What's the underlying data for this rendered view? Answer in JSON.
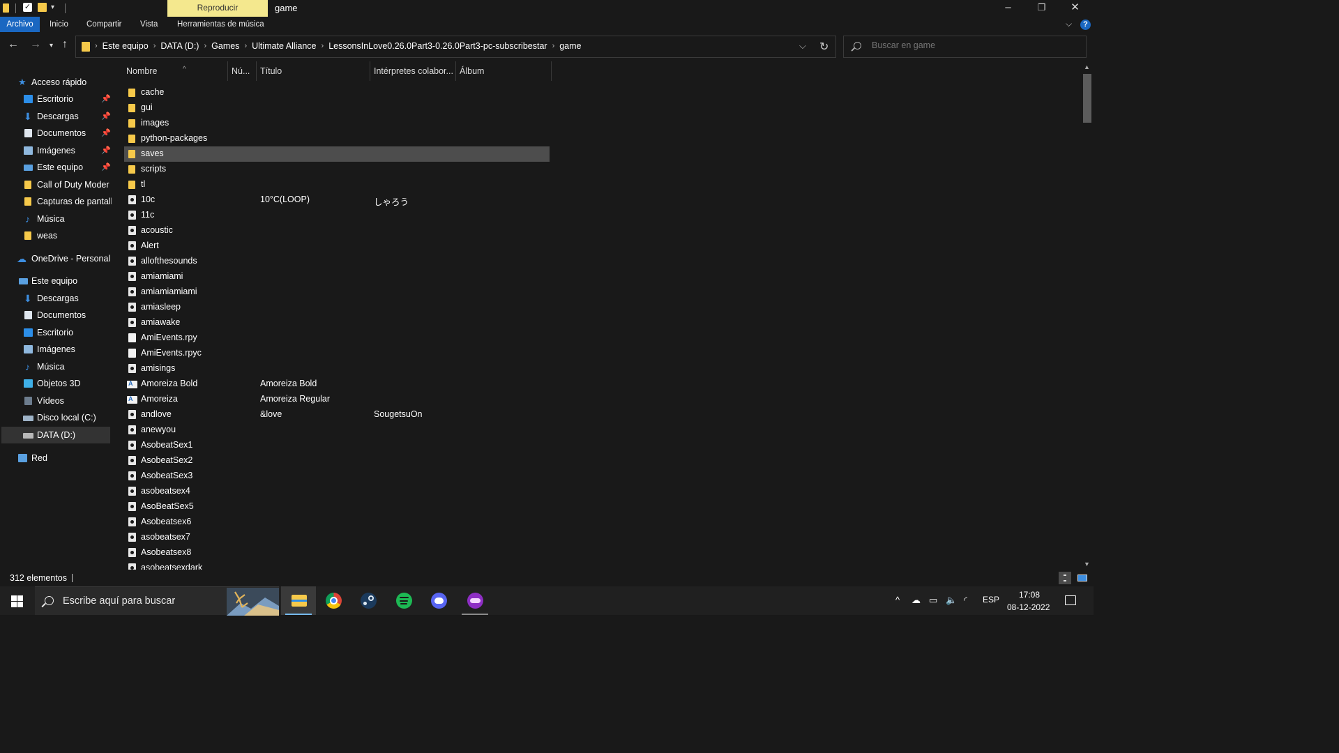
{
  "window": {
    "title": "game",
    "contextual_tab": "Reproducir"
  },
  "ribbon": {
    "tabs": [
      "Archivo",
      "Inicio",
      "Compartir",
      "Vista",
      "Herramientas de música"
    ]
  },
  "address": {
    "crumbs": [
      "Este equipo",
      "DATA (D:)",
      "Games",
      "Ultimate Alliance",
      "LessonsInLove0.26.0Part3-0.26.0Part3-pc-subscribestar",
      "game"
    ]
  },
  "search": {
    "placeholder": "Buscar en game"
  },
  "nav": {
    "quick_access": "Acceso rápido",
    "quick_items": [
      "Escritorio",
      "Descargas",
      "Documentos",
      "Imágenes",
      "Este equipo",
      "Call of Duty  Moder",
      "Capturas de pantall",
      "Música",
      "weas"
    ],
    "onedrive": "OneDrive - Personal",
    "this_pc": "Este equipo",
    "pc_items": [
      "Descargas",
      "Documentos",
      "Escritorio",
      "Imágenes",
      "Música",
      "Objetos 3D",
      "Vídeos",
      "Disco local (C:)",
      "DATA (D:)"
    ],
    "network": "Red"
  },
  "columns": [
    "Nombre",
    "Nú...",
    "Título",
    "Intérpretes colabor...",
    "Álbum"
  ],
  "files": [
    {
      "name": "cache",
      "type": "folder",
      "title": "",
      "artist": ""
    },
    {
      "name": "gui",
      "type": "folder",
      "title": "",
      "artist": ""
    },
    {
      "name": "images",
      "type": "folder",
      "title": "",
      "artist": ""
    },
    {
      "name": "python-packages",
      "type": "folder",
      "title": "",
      "artist": ""
    },
    {
      "name": "saves",
      "type": "folder",
      "title": "",
      "artist": ""
    },
    {
      "name": "scripts",
      "type": "folder",
      "title": "",
      "artist": ""
    },
    {
      "name": "tl",
      "type": "folder",
      "title": "",
      "artist": ""
    },
    {
      "name": "10c",
      "type": "audio",
      "title": "10°C(LOOP)",
      "artist": "しゃろう"
    },
    {
      "name": "11c",
      "type": "audio",
      "title": "",
      "artist": ""
    },
    {
      "name": "acoustic",
      "type": "audio",
      "title": "",
      "artist": ""
    },
    {
      "name": "Alert",
      "type": "audio",
      "title": "",
      "artist": ""
    },
    {
      "name": "allofthesounds",
      "type": "audio",
      "title": "",
      "artist": ""
    },
    {
      "name": "amiamiami",
      "type": "audio",
      "title": "",
      "artist": ""
    },
    {
      "name": "amiamiamiami",
      "type": "audio",
      "title": "",
      "artist": ""
    },
    {
      "name": "amiasleep",
      "type": "audio",
      "title": "",
      "artist": ""
    },
    {
      "name": "amiawake",
      "type": "audio",
      "title": "",
      "artist": ""
    },
    {
      "name": "AmiEvents.rpy",
      "type": "doc",
      "title": "",
      "artist": ""
    },
    {
      "name": "AmiEvents.rpyc",
      "type": "doc",
      "title": "",
      "artist": ""
    },
    {
      "name": "amisings",
      "type": "audio",
      "title": "",
      "artist": ""
    },
    {
      "name": "Amoreiza Bold",
      "type": "font",
      "title": "Amoreiza Bold",
      "artist": ""
    },
    {
      "name": "Amoreiza",
      "type": "font",
      "title": "Amoreiza Regular",
      "artist": ""
    },
    {
      "name": "andlove",
      "type": "audio",
      "title": "&love",
      "artist": "SougetsuOn"
    },
    {
      "name": "anewyou",
      "type": "audio",
      "title": "",
      "artist": ""
    },
    {
      "name": "AsobeatSex1",
      "type": "audio",
      "title": "",
      "artist": ""
    },
    {
      "name": "AsobeatSex2",
      "type": "audio",
      "title": "",
      "artist": ""
    },
    {
      "name": "AsobeatSex3",
      "type": "audio",
      "title": "",
      "artist": ""
    },
    {
      "name": "asobeatsex4",
      "type": "audio",
      "title": "",
      "artist": ""
    },
    {
      "name": "AsoBeatSex5",
      "type": "audio",
      "title": "",
      "artist": ""
    },
    {
      "name": "Asobeatsex6",
      "type": "audio",
      "title": "",
      "artist": ""
    },
    {
      "name": "asobeatsex7",
      "type": "audio",
      "title": "",
      "artist": ""
    },
    {
      "name": "Asobeatsex8",
      "type": "audio",
      "title": "",
      "artist": ""
    },
    {
      "name": "asobeatsexdark",
      "type": "audio",
      "title": "",
      "artist": ""
    }
  ],
  "selected_file": "saves",
  "status": {
    "count": "312 elementos"
  },
  "taskbar": {
    "search_text": "Escribe aquí para buscar",
    "apps": [
      "file-explorer",
      "chrome",
      "steam",
      "spotify",
      "discord",
      "app"
    ],
    "language": "ESP",
    "time": "17:08",
    "date": "08-12-2022"
  },
  "colors": {
    "accent": "#1a67c1",
    "folder": "#f6c94a",
    "contextual_tab": "#f4e88e",
    "selection": "#4d4d4d",
    "background": "#191919"
  }
}
